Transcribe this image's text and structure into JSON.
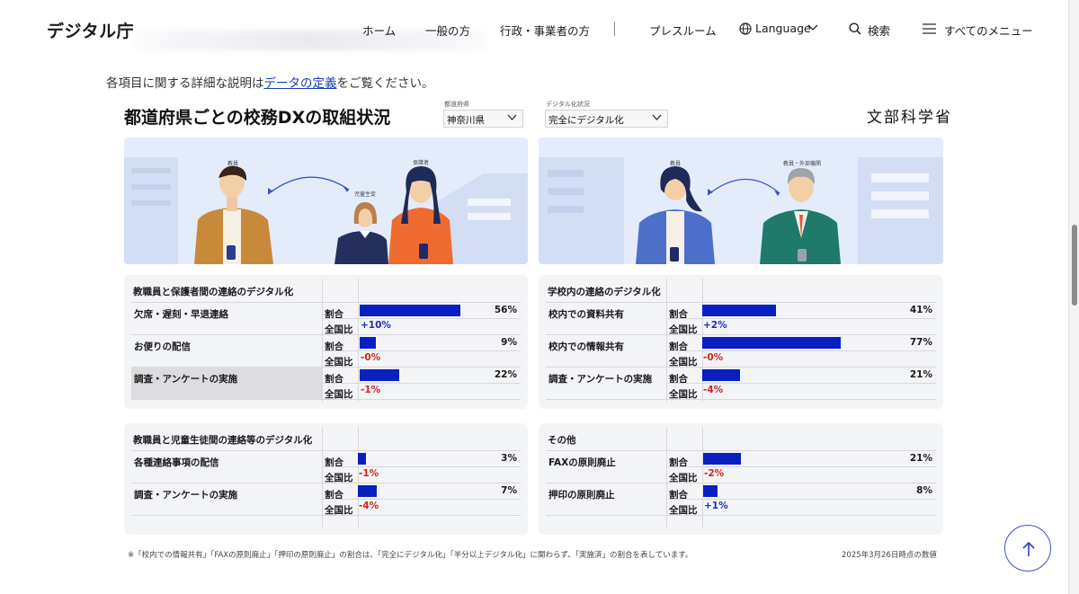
{
  "header": {
    "logo": "デジタル庁",
    "nav": [
      "ホーム",
      "一般の方",
      "行政・事業者の方",
      "プレスルーム"
    ],
    "language": "Language",
    "search": "検索",
    "menu": "すべてのメニュー"
  },
  "intro": {
    "before": "各項目に関する詳細な説明は",
    "link": "データの定義",
    "after": "をご覧ください。"
  },
  "board": {
    "title": "都道府県ごとの校務DXの取組状況",
    "prefecture_label": "都道府県",
    "prefecture_value": "神奈川県",
    "status_label": "デジタル化状況",
    "status_value": "完全にデジタル化",
    "ministry": "文部科学省"
  },
  "illustrations": {
    "left": {
      "teacher": "教員",
      "parent": "保護者",
      "student": "児童生徒"
    },
    "right": {
      "teacher": "教員",
      "external": "教員・外部機関"
    }
  },
  "labels": {
    "ratio": "割合",
    "national": "全国比"
  },
  "cards": [
    {
      "title": "教職員と保護者間の連絡のデジタル化",
      "rows": [
        {
          "name": "欠席・遅刻・早退連絡",
          "pct_label": "56%",
          "pct": 56,
          "delta": "+10%",
          "sign": "pos"
        },
        {
          "name": "お便りの配信",
          "pct_label": "9%",
          "pct": 9,
          "delta": "-0%",
          "sign": "neg"
        },
        {
          "name": "調査・アンケートの実施",
          "pct_label": "22%",
          "pct": 22,
          "delta": "-1%",
          "sign": "neg",
          "highlight": true
        }
      ]
    },
    {
      "title": "学校内の連絡のデジタル化",
      "rows": [
        {
          "name": "校内での資料共有",
          "pct_label": "41%",
          "pct": 41,
          "delta": "+2%",
          "sign": "pos"
        },
        {
          "name": "校内での情報共有",
          "pct_label": "77%",
          "pct": 77,
          "delta": "-0%",
          "sign": "neg"
        },
        {
          "name": "調査・アンケートの実施",
          "pct_label": "21%",
          "pct": 21,
          "delta": "-4%",
          "sign": "neg"
        }
      ]
    },
    {
      "title": "教職員と児童生徒間の連絡等のデジタル化",
      "rows": [
        {
          "name": "各種連絡事項の配信",
          "pct_label": "3%",
          "pct": 3,
          "delta": "-1%",
          "sign": "neg"
        },
        {
          "name": "調査・アンケートの実施",
          "pct_label": "7%",
          "pct": 7,
          "delta": "-4%",
          "sign": "neg"
        }
      ]
    },
    {
      "title": "その他",
      "rows": [
        {
          "name": "FAXの原則廃止",
          "pct_label": "21%",
          "pct": 21,
          "delta": "-2%",
          "sign": "neg"
        },
        {
          "name": "押印の原則廃止",
          "pct_label": "8%",
          "pct": 8,
          "delta": "+1%",
          "sign": "pos"
        }
      ]
    }
  ],
  "footnote": "※「校内での情報共有」「FAXの原則廃止」「押印の原則廃止」の割合は、「完全にデジタル化」「半分以上デジタル化」に関わらず、「実施済」の割合を表しています。",
  "asof": "2025年3月26日時点の数値",
  "colors": {
    "bar": "#0a1fc2",
    "positive": "#1a2fb5",
    "negative": "#d21f1f",
    "illustration_bg": "#e4ecfb"
  }
}
